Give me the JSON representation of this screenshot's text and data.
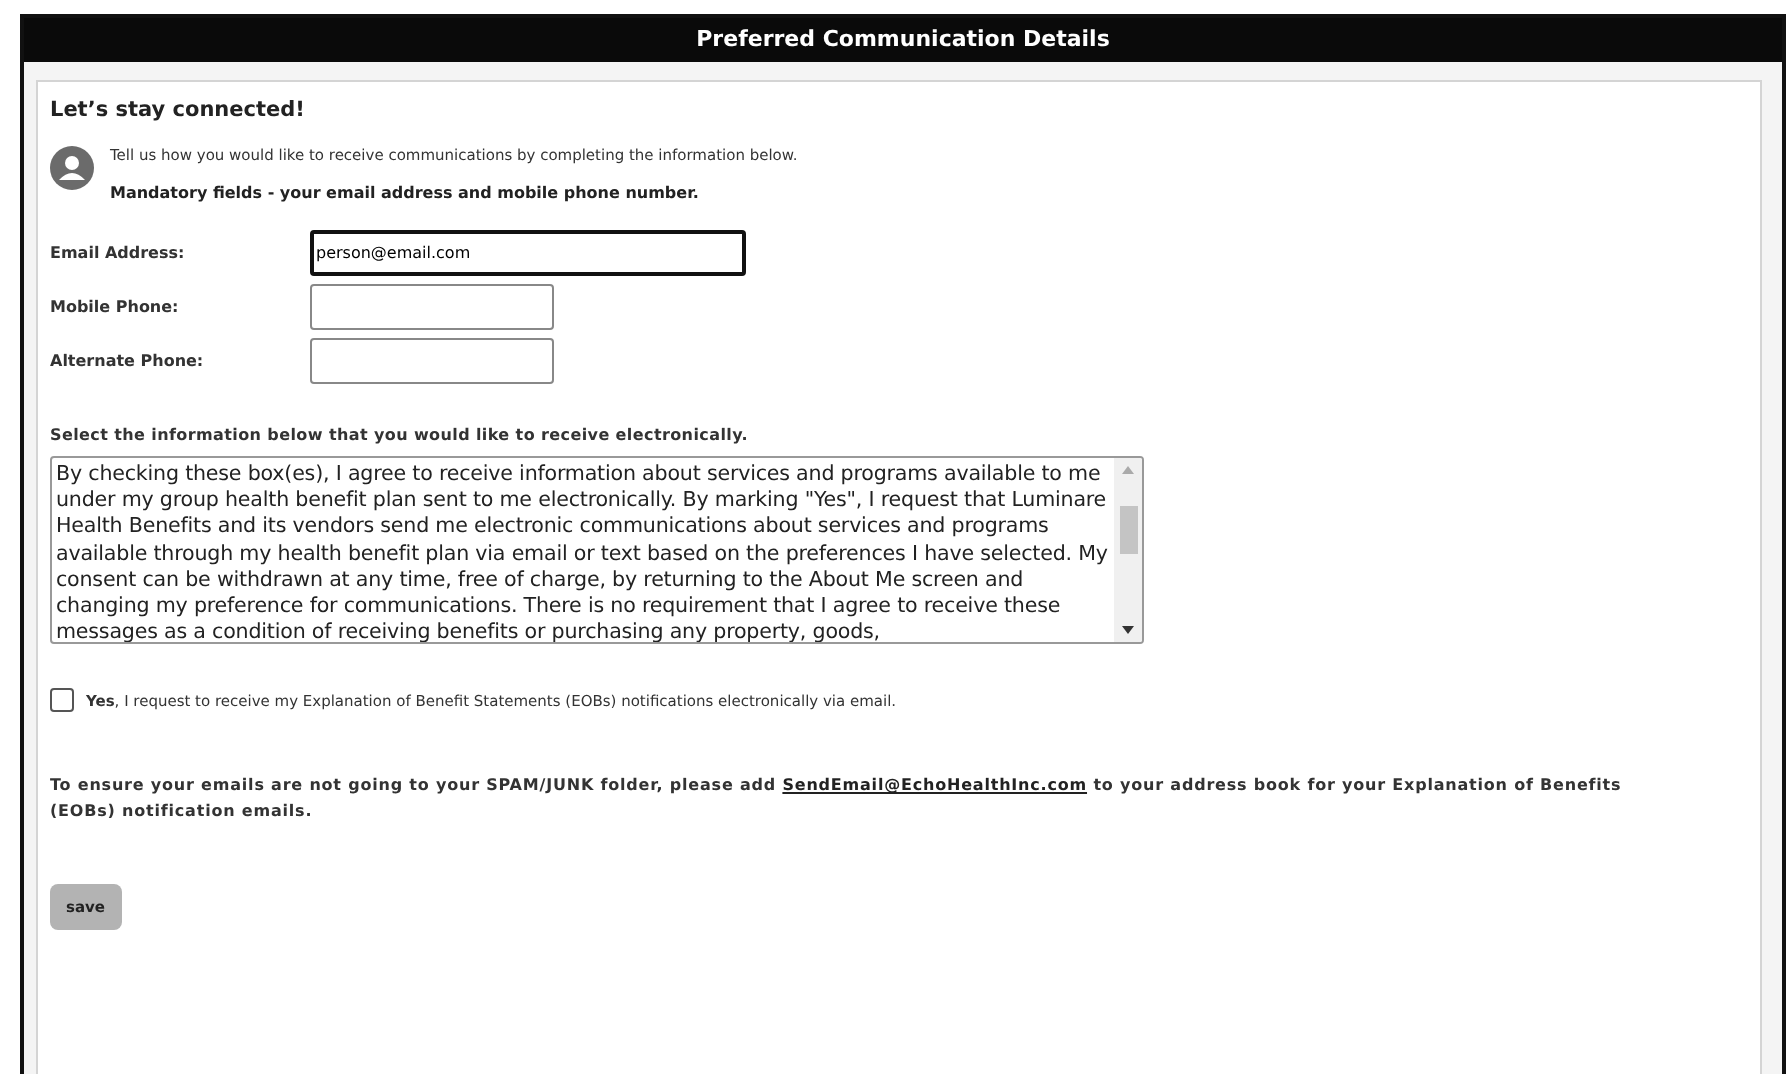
{
  "window": {
    "title": "Preferred Communication Details"
  },
  "heading": "Let’s stay connected!",
  "intro": "Tell us how you would like to receive communications by completing the information below.",
  "mandatory_note": "Mandatory fields - your email address and mobile phone number.",
  "fields": [
    {
      "label": "Email Address:",
      "value": "person@email.com",
      "focused": true
    },
    {
      "label": "Mobile Phone:",
      "focused": false
    },
    {
      "label": "Alternate Phone:",
      "focused": false
    }
  ],
  "consent": {
    "prompt": "Select the information below that you would like to receive electronically.",
    "text": "By checking these box(es), I agree to receive information about services and programs available to me under my group health benefit plan sent to me electronically. By marking \"Yes\", I request that Luminare Health Benefits and its vendors send me electronic communications about services and programs available through my health benefit plan via email or text based on the preferences I have selected. My consent can be withdrawn at any time, free of charge, by returning to the About Me screen and changing my preference for communications. There is no requirement that I agree to receive these messages as a condition of receiving benefits or purchasing any property, goods,"
  },
  "options": [
    {
      "label": "**Yes**, I request to receive my Explanation of Benefit Statements (EOBs) notifications electronically via email.",
      "checked": false
    }
  ],
  "spam_note": {
    "before": "To ensure your emails are not going to your SPAM/JUNK folder, please add",
    "link": "SendEmail@EchoHealthInc.com",
    "after": "to your address book for your Explanation of Benefits (EOBs) notification emails."
  },
  "buttons": [
    "save"
  ]
}
